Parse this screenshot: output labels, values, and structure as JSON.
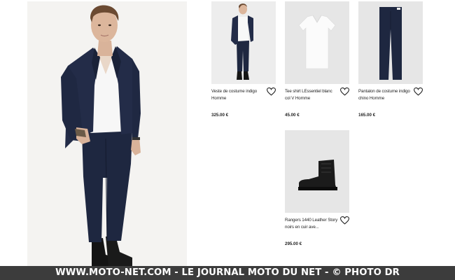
{
  "products": [
    {
      "name": "Veste de costume indigo Homme",
      "price": "325.00 €"
    },
    {
      "name": "Tee shirt LEssentiel blanc col V Homme",
      "price": "45.00 €"
    },
    {
      "name": "Pantalon de costume indigo chino Homme",
      "price": "165.00 €"
    },
    {
      "name": "Rangers 1440 Leather Story noirs en cuir ave...",
      "price": "295.00 €"
    }
  ],
  "watermark": "WWW.MOTO-NET.COM - LE JOURNAL MOTO DU NET - © PHOTO DR",
  "colors": {
    "suit": "#1e2740",
    "tile_bg": "#eaeaea",
    "banner_bg": "#3c3c3c"
  },
  "icons": {
    "favorite": "heart-outline-icon"
  }
}
